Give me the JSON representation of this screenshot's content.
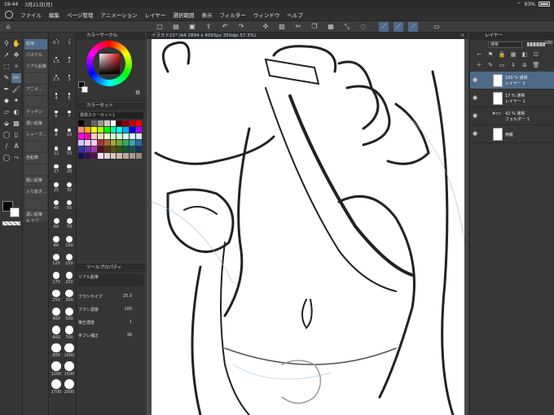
{
  "status": {
    "time": "19:44",
    "date": "3月21日(月)",
    "battery": "93%"
  },
  "menu": [
    "ファイル",
    "編集",
    "ページ管理",
    "アニメーション",
    "レイヤー",
    "選択範囲",
    "表示",
    "フィルター",
    "ウィンドウ",
    "ヘルプ"
  ],
  "subtools": [
    "鉛筆",
    "パステル",
    "リアル鉛筆",
    "",
    "アニメ…",
    "",
    "デッサン",
    "濃い鉛筆",
    "シャープ…",
    "",
    "色鉛筆",
    "",
    "粗い鉛筆",
    "入り抜き…",
    "",
    "濃い鉛筆"
  ],
  "subtool_add_label": "サブ…",
  "brush_sizes": [
    "0.7",
    "1",
    "1.5",
    "2",
    "2.5",
    "3",
    "4",
    "5",
    "6",
    "7",
    "8",
    "10",
    "12",
    "15",
    "17",
    "20",
    "25",
    "30",
    "40",
    "50",
    "60",
    "70",
    "80",
    "100",
    "120",
    "150",
    "170",
    "200",
    "250",
    "300",
    "400",
    "500",
    "600",
    "700",
    "800",
    "1000",
    "1200",
    "1500",
    "1700",
    "2000"
  ],
  "color_wheel": {
    "title": "カラーサークル"
  },
  "color_set": {
    "title": "カラーセット",
    "set_name": "標準カラーセット1"
  },
  "tool_property": {
    "title": "ツールプロパティ",
    "tool_name": "リアル鉛筆",
    "brush_size_label": "ブラシサイズ",
    "brush_size_value": "25.0",
    "brush_density_label": "ブラシ濃度",
    "brush_density_value": "100",
    "pressure_label": "筆圧濃度",
    "pressure_value": "1",
    "stabilization_label": "手ブレ補正",
    "stabilization_value": "36"
  },
  "canvas_tab": "イラスト21* (A4 2894 x 4093px 350dpi 57.3%)",
  "layers": {
    "title": "レイヤー",
    "blend_mode": "通常",
    "opacity": "100",
    "items": [
      {
        "pct": "100 % 通常",
        "name": "レイヤー 2",
        "selected": true
      },
      {
        "pct": "17 % 通常",
        "name": "レイヤー 1",
        "selected": false
      },
      {
        "pct": "42 % 通常",
        "name": "フォルダー 1",
        "selected": false
      },
      {
        "pct": "",
        "name": "用紙",
        "selected": false
      }
    ]
  },
  "colors": {
    "accent": "#5a7290",
    "panel": "#353535",
    "canvas_bg": "#ffffff"
  }
}
